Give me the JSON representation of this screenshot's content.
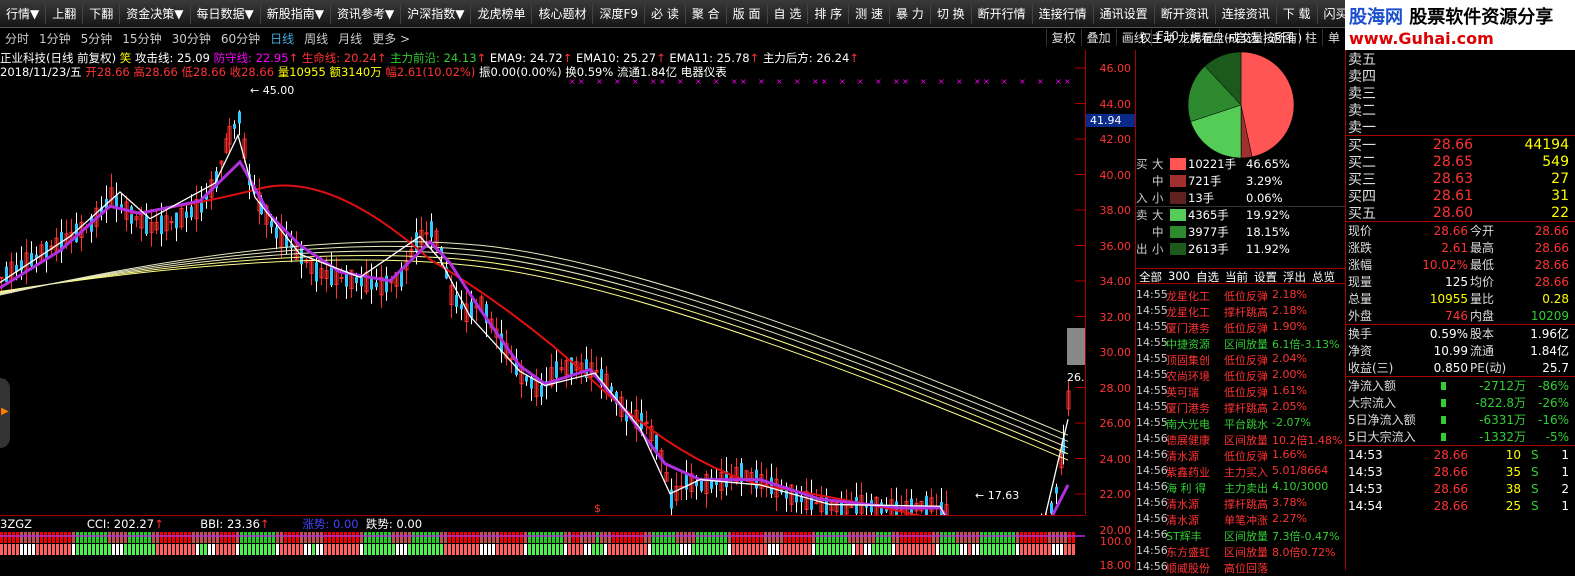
{
  "menu": [
    "行情▼",
    "上翻",
    "下翻",
    "资金决策▼",
    "每日数据▼",
    "新股指南▼",
    "资讯参考▼",
    "沪深指数▼",
    "龙虎榜单",
    "核心题材",
    "深度F9",
    "必 读",
    "聚 合",
    "版 面",
    "自 选",
    "排 序",
    "测 速",
    "暴 力",
    "切 换",
    "断开行情",
    "连接行情",
    "通讯设置",
    "断开资讯",
    "连接资讯",
    "下 载",
    "闪买卖"
  ],
  "logo": {
    "site": "股海网",
    "slogan": "股票软件资源分享",
    "url": "www.Guhai.com"
  },
  "periods": [
    "分时",
    "1分钟",
    "5分钟",
    "15分钟",
    "30分钟",
    "60分钟",
    "日线",
    "周线",
    "月线",
    "更多 >"
  ],
  "right_buttons": [
    "复权",
    "叠加",
    "画线",
    "F10",
    "标记",
    "+自选",
    "返回",
    "柱",
    "单"
  ],
  "panel_title": "仅主动 龙虎看盘(成交量按所有)",
  "info1": {
    "stock": "正业科技(日线 前复权)",
    "flag": "笑",
    "attack": "攻击线: 25.09",
    "defend": "防守线: 22.95",
    "life": "生命线: 20.24",
    "lead": "主力前沿: 24.13",
    "ema9": "EMA9: 24.72",
    "ema10": "EMA10: 25.27",
    "ema11": "EMA11: 25.78",
    "back": "主力后方: 26.24"
  },
  "info2": {
    "date": "2018/11/23/五",
    "open": "开28.66",
    "high": "高28.66",
    "low": "低28.66",
    "close": "收28.66",
    "vol": "量10955",
    "amt": "额3140万",
    "chg": "幅2.61(10.02%)",
    "amp": "振0.00(0.00%)",
    "turn": "换0.59%",
    "float": "流通1.84亿",
    "ind": "电器仪表"
  },
  "yaxis": [
    "46.00",
    "44.00",
    "42.00",
    "40.00",
    "38.00",
    "36.00",
    "34.00",
    "32.00",
    "30.00",
    "28.00",
    "26.00",
    "24.00",
    "22.00",
    "20.00",
    "18.00"
  ],
  "price_tag": "41.94",
  "high_label": "45.00",
  "low_label": "17.63",
  "right_label": "26.",
  "sub": {
    "code": "3ZGZ",
    "cci": "CCI: 202.27",
    "bbi": "BBI: 23.36",
    "up": "涨势: 0.00",
    "down": "跌势: 0.00",
    "axis": "100.0"
  },
  "flow": [
    {
      "side": "买",
      "size": "大",
      "color": "#ff5555",
      "vol": "10221手",
      "pct": "46.65%"
    },
    {
      "side": "",
      "size": "中",
      "color": "#a03030",
      "vol": "721手",
      "pct": "3.29%"
    },
    {
      "side": "入",
      "size": "小",
      "color": "#602020",
      "vol": "13手",
      "pct": "0.06%"
    },
    {
      "side": "卖",
      "size": "大",
      "color": "#55cc55",
      "vol": "4365手",
      "pct": "19.92%"
    },
    {
      "side": "",
      "size": "中",
      "color": "#2e8a2e",
      "vol": "3977手",
      "pct": "18.15%"
    },
    {
      "side": "出",
      "size": "小",
      "color": "#1b5a1b",
      "vol": "2613手",
      "pct": "11.92%"
    }
  ],
  "tabs": [
    "全部",
    "300",
    "自选",
    "当前",
    "设置",
    "浮出",
    "总览"
  ],
  "alerts": [
    {
      "t": "14:55",
      "n": "龙星化工",
      "e": "低位反弹",
      "v": "2.18%",
      "nc": "#f33",
      "vc": "#f33"
    },
    {
      "t": "14:55",
      "n": "龙星化工",
      "e": "撑杆跳高",
      "v": "2.18%",
      "nc": "#f33",
      "vc": "#f33"
    },
    {
      "t": "14:55",
      "n": "厦门港务",
      "e": "低位反弹",
      "v": "1.90%",
      "nc": "#f33",
      "vc": "#f33"
    },
    {
      "t": "14:55",
      "n": "中捷资源",
      "e": "区间放量",
      "v": "6.1倍-3.13%",
      "nc": "#3c3",
      "vc": "#3c3"
    },
    {
      "t": "14:55",
      "n": "顶固集创",
      "e": "低位反弹",
      "v": "2.04%",
      "nc": "#f33",
      "vc": "#f33"
    },
    {
      "t": "14:55",
      "n": "农尚环境",
      "e": "低位反弹",
      "v": "2.00%",
      "nc": "#f33",
      "vc": "#f33"
    },
    {
      "t": "14:55",
      "n": "英可瑞",
      "e": "低位反弹",
      "v": "1.61%",
      "nc": "#f33",
      "vc": "#f33"
    },
    {
      "t": "14:55",
      "n": "厦门港务",
      "e": "撑杆跳高",
      "v": "2.05%",
      "nc": "#f33",
      "vc": "#f33"
    },
    {
      "t": "14:55",
      "n": "南大光电",
      "e": "平台跳水",
      "v": "-2.07%",
      "nc": "#3c3",
      "vc": "#3c3"
    },
    {
      "t": "14:56",
      "n": "德展健康",
      "e": "区间放量",
      "v": "10.2倍1.48%",
      "nc": "#f33",
      "vc": "#f33"
    },
    {
      "t": "14:56",
      "n": "清水源",
      "e": "低位反弹",
      "v": "1.66%",
      "nc": "#f33",
      "vc": "#f33"
    },
    {
      "t": "14:56",
      "n": "紫鑫药业",
      "e": "主力买入",
      "v": "5.01/8664",
      "nc": "#f33",
      "vc": "#f33"
    },
    {
      "t": "14:56",
      "n": "海 利 得",
      "e": "主力卖出",
      "v": "4.10/3000",
      "nc": "#3c3",
      "vc": "#3c3"
    },
    {
      "t": "14:56",
      "n": "清水源",
      "e": "撑杆跳高",
      "v": "3.78%",
      "nc": "#f33",
      "vc": "#f33"
    },
    {
      "t": "14:56",
      "n": "清水源",
      "e": "单笔冲涨",
      "v": "2.27%",
      "nc": "#f33",
      "vc": "#f33"
    },
    {
      "t": "14:56",
      "n": "ST辉丰",
      "e": "区间放量",
      "v": "7.3倍-0.47%",
      "nc": "#3c3",
      "vc": "#3c3"
    },
    {
      "t": "14:56",
      "n": "东方盛虹",
      "e": "区间放量",
      "v": "8.0倍0.72%",
      "nc": "#f33",
      "vc": "#f33"
    },
    {
      "t": "14:56",
      "n": "顺威股份",
      "e": "高位回落",
      "v": "",
      "nc": "#f33",
      "vc": "#f33"
    }
  ],
  "sell": [
    "卖五",
    "卖四",
    "卖三",
    "卖二",
    "卖一"
  ],
  "buy": [
    {
      "lb": "买一",
      "px": "28.66",
      "vl": "44194"
    },
    {
      "lb": "买二",
      "px": "28.65",
      "vl": "549"
    },
    {
      "lb": "买三",
      "px": "28.63",
      "vl": "27"
    },
    {
      "lb": "买四",
      "px": "28.61",
      "vl": "31"
    },
    {
      "lb": "买五",
      "px": "28.60",
      "vl": "22"
    }
  ],
  "quote": [
    {
      "a": "现价",
      "b": "28.66",
      "bc": "#f33",
      "c": "今开",
      "d": "28.66",
      "dc": "#f33"
    },
    {
      "a": "涨跌",
      "b": "2.61",
      "bc": "#f33",
      "c": "最高",
      "d": "28.66",
      "dc": "#f33"
    },
    {
      "a": "涨幅",
      "b": "10.02%",
      "bc": "#f33",
      "c": "最低",
      "d": "28.66",
      "dc": "#f33"
    },
    {
      "a": "现量",
      "b": "125",
      "bc": "#fff",
      "c": "均价",
      "d": "28.66",
      "dc": "#f33"
    },
    {
      "a": "总量",
      "b": "10955",
      "bc": "#ff0",
      "c": "量比",
      "d": "0.28",
      "dc": "#ff0"
    },
    {
      "a": "外盘",
      "b": "746",
      "bc": "#f33",
      "c": "内盘",
      "d": "10209",
      "dc": "#3c3"
    }
  ],
  "quote2": [
    {
      "a": "换手",
      "b": "0.59%",
      "bc": "#fff",
      "c": "股本",
      "d": "1.96亿",
      "dc": "#fff"
    },
    {
      "a": "净资",
      "b": "10.99",
      "bc": "#fff",
      "c": "流通",
      "d": "1.84亿",
      "dc": "#fff"
    },
    {
      "a": "收益(三)",
      "b": "0.850",
      "bc": "#fff",
      "c": "PE(动)",
      "d": "25.7",
      "dc": "#fff"
    }
  ],
  "fund": [
    {
      "a": "净流入额",
      "b": "-2712万",
      "c": "-86%"
    },
    {
      "a": "大宗流入",
      "b": "-822.8万",
      "c": "-26%"
    },
    {
      "a": "5日净流入额",
      "b": "-6331万",
      "c": "-16%"
    },
    {
      "a": "5日大宗流入",
      "b": "-1332万",
      "c": "-5%"
    }
  ],
  "ticks": [
    {
      "t": "14:53",
      "p": "28.66",
      "v": "10",
      "s": "S",
      "n": "1"
    },
    {
      "t": "14:53",
      "p": "28.66",
      "v": "35",
      "s": "S",
      "n": "1"
    },
    {
      "t": "14:53",
      "p": "28.66",
      "v": "38",
      "s": "S",
      "n": "2"
    },
    {
      "t": "14:54",
      "p": "28.66",
      "v": "25",
      "s": "S",
      "n": "1"
    }
  ]
}
